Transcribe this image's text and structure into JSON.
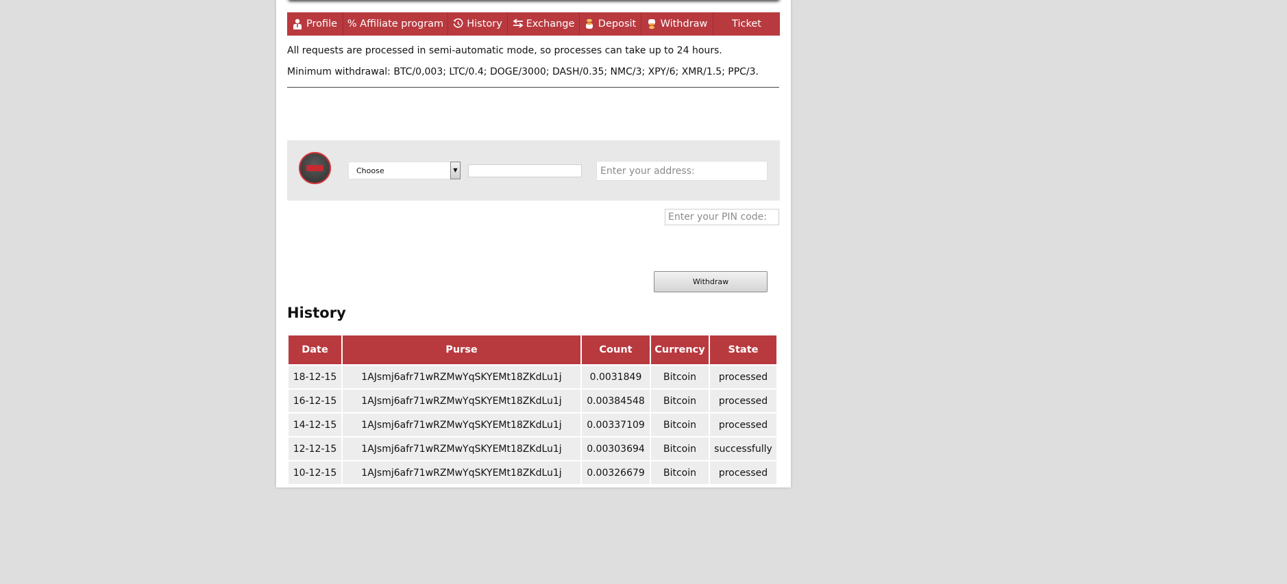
{
  "nav": {
    "items": [
      {
        "label": "Profile",
        "icon": "person-icon"
      },
      {
        "label": "% Affiliate program",
        "icon": ""
      },
      {
        "label": "History",
        "icon": "history-icon"
      },
      {
        "label": "Exchange",
        "icon": "exchange-arrows-icon"
      },
      {
        "label": "Deposit",
        "icon": "coin-stack-icon"
      },
      {
        "label": "Withdraw",
        "icon": "coin-stack-icon"
      },
      {
        "label": "Ticket",
        "icon": ""
      }
    ]
  },
  "info": {
    "line1": "All requests are processed in semi-automatic mode, so processes can take up to 24 hours.",
    "line2": "Minimum withdrawal: BTC/0,003; LTC/0.4; DOGE/3000; DASH/0.35; NMC/3; XPY/6; XMR/1.5; PPC/3."
  },
  "form": {
    "currency_select": "Choose",
    "amount_value": "",
    "address_placeholder": "Enter your address:",
    "pin_placeholder": "Enter your PIN code:",
    "submit_label": "Withdraw"
  },
  "history": {
    "title": "History",
    "columns": [
      "Date",
      "Purse",
      "Count",
      "Currency",
      "State"
    ],
    "rows": [
      [
        "18-12-15",
        "1AJsmj6afr71wRZMwYqSKYEMt18ZKdLu1j",
        "0.0031849",
        "Bitcoin",
        "processed"
      ],
      [
        "16-12-15",
        "1AJsmj6afr71wRZMwYqSKYEMt18ZKdLu1j",
        "0.00384548",
        "Bitcoin",
        "processed"
      ],
      [
        "14-12-15",
        "1AJsmj6afr71wRZMwYqSKYEMt18ZKdLu1j",
        "0.00337109",
        "Bitcoin",
        "processed"
      ],
      [
        "12-12-15",
        "1AJsmj6afr71wRZMwYqSKYEMt18ZKdLu1j",
        "0.00303694",
        "Bitcoin",
        "successfully"
      ],
      [
        "10-12-15",
        "1AJsmj6afr71wRZMwYqSKYEMt18ZKdLu1j",
        "0.00326679",
        "Bitcoin",
        "processed"
      ]
    ]
  },
  "colors": {
    "accent": "#b83a3f",
    "page_background": "#dedede",
    "band_background": "#e8e8e8",
    "cell_background": "#ededed"
  }
}
